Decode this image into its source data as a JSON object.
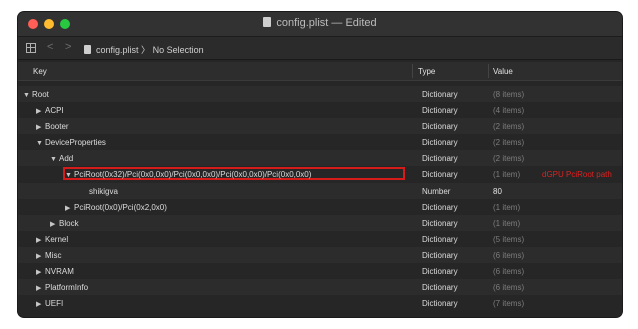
{
  "window": {
    "title": "config.plist — Edited"
  },
  "toolbar": {
    "filename": "config.plist",
    "selection": "No Selection",
    "separator": "〉"
  },
  "columns": {
    "key": "Key",
    "type": "Type",
    "value": "Value"
  },
  "rows": [
    {
      "key": "Root",
      "type": "Dictionary",
      "value": "(8 items)",
      "expanded": true
    },
    {
      "key": "ACPI",
      "type": "Dictionary",
      "value": "(4 items)",
      "expanded": false
    },
    {
      "key": "Booter",
      "type": "Dictionary",
      "value": "(2 items)",
      "expanded": false
    },
    {
      "key": "DeviceProperties",
      "type": "Dictionary",
      "value": "(2 items)",
      "expanded": true
    },
    {
      "key": "Add",
      "type": "Dictionary",
      "value": "(2 items)",
      "expanded": true
    },
    {
      "key": "PciRoot(0x32)/Pci(0x0,0x0)/Pci(0x0,0x0)/Pci(0x0,0x0)/Pci(0x0,0x0)",
      "type": "Dictionary",
      "value": "(1 item)",
      "expanded": true,
      "annotation": "dGPU PciRoot path"
    },
    {
      "key": "shikigva",
      "type": "Number",
      "value": "80"
    },
    {
      "key": "PciRoot(0x0)/Pci(0x2,0x0)",
      "type": "Dictionary",
      "value": "(1 item)",
      "expanded": false
    },
    {
      "key": "Block",
      "type": "Dictionary",
      "value": "(1 item)",
      "expanded": false
    },
    {
      "key": "Kernel",
      "type": "Dictionary",
      "value": "(5 items)",
      "expanded": false
    },
    {
      "key": "Misc",
      "type": "Dictionary",
      "value": "(6 items)",
      "expanded": false
    },
    {
      "key": "NVRAM",
      "type": "Dictionary",
      "value": "(6 items)",
      "expanded": false
    },
    {
      "key": "PlatformInfo",
      "type": "Dictionary",
      "value": "(6 items)",
      "expanded": false
    },
    {
      "key": "UEFI",
      "type": "Dictionary",
      "value": "(7 items)",
      "expanded": false
    }
  ],
  "icons": {
    "expanded": "▼",
    "collapsed": "▶",
    "back": "<",
    "forward": ">"
  },
  "colors": {
    "highlight": "#d61b1b",
    "annotation": "#e02020"
  }
}
